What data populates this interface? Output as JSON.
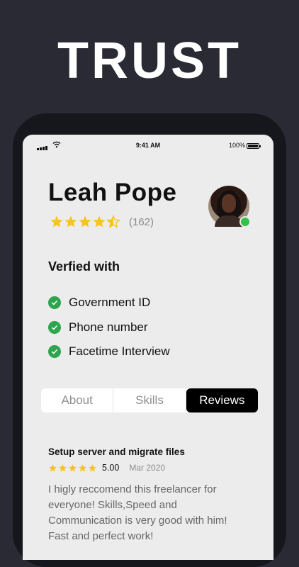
{
  "headline": "TRUST",
  "status_bar": {
    "time": "9:41 AM",
    "battery": "100%"
  },
  "profile": {
    "name": "Leah Pope",
    "rating": 4.5,
    "rating_count": "(162)",
    "online": true
  },
  "verification": {
    "title": "Verfied with",
    "items": [
      {
        "label": "Government ID"
      },
      {
        "label": "Phone number"
      },
      {
        "label": "Facetime Interview"
      }
    ]
  },
  "tabs": [
    {
      "label": "About",
      "active": false
    },
    {
      "label": "Skills",
      "active": false
    },
    {
      "label": "Reviews",
      "active": true
    }
  ],
  "review": {
    "title": "Setup server and migrate files",
    "stars": 5,
    "score": "5.00",
    "date": "Mar 2020",
    "text": "I higly reccomend this freelancer for everyone! Skills,Speed and Communication is very good with him! Fast and perfect work!"
  },
  "colors": {
    "background": "#2a2a34",
    "screen": "#ececec",
    "star": "#f5c518",
    "check": "#2da44e",
    "online": "#35c24a",
    "tab_active": "#000000"
  }
}
